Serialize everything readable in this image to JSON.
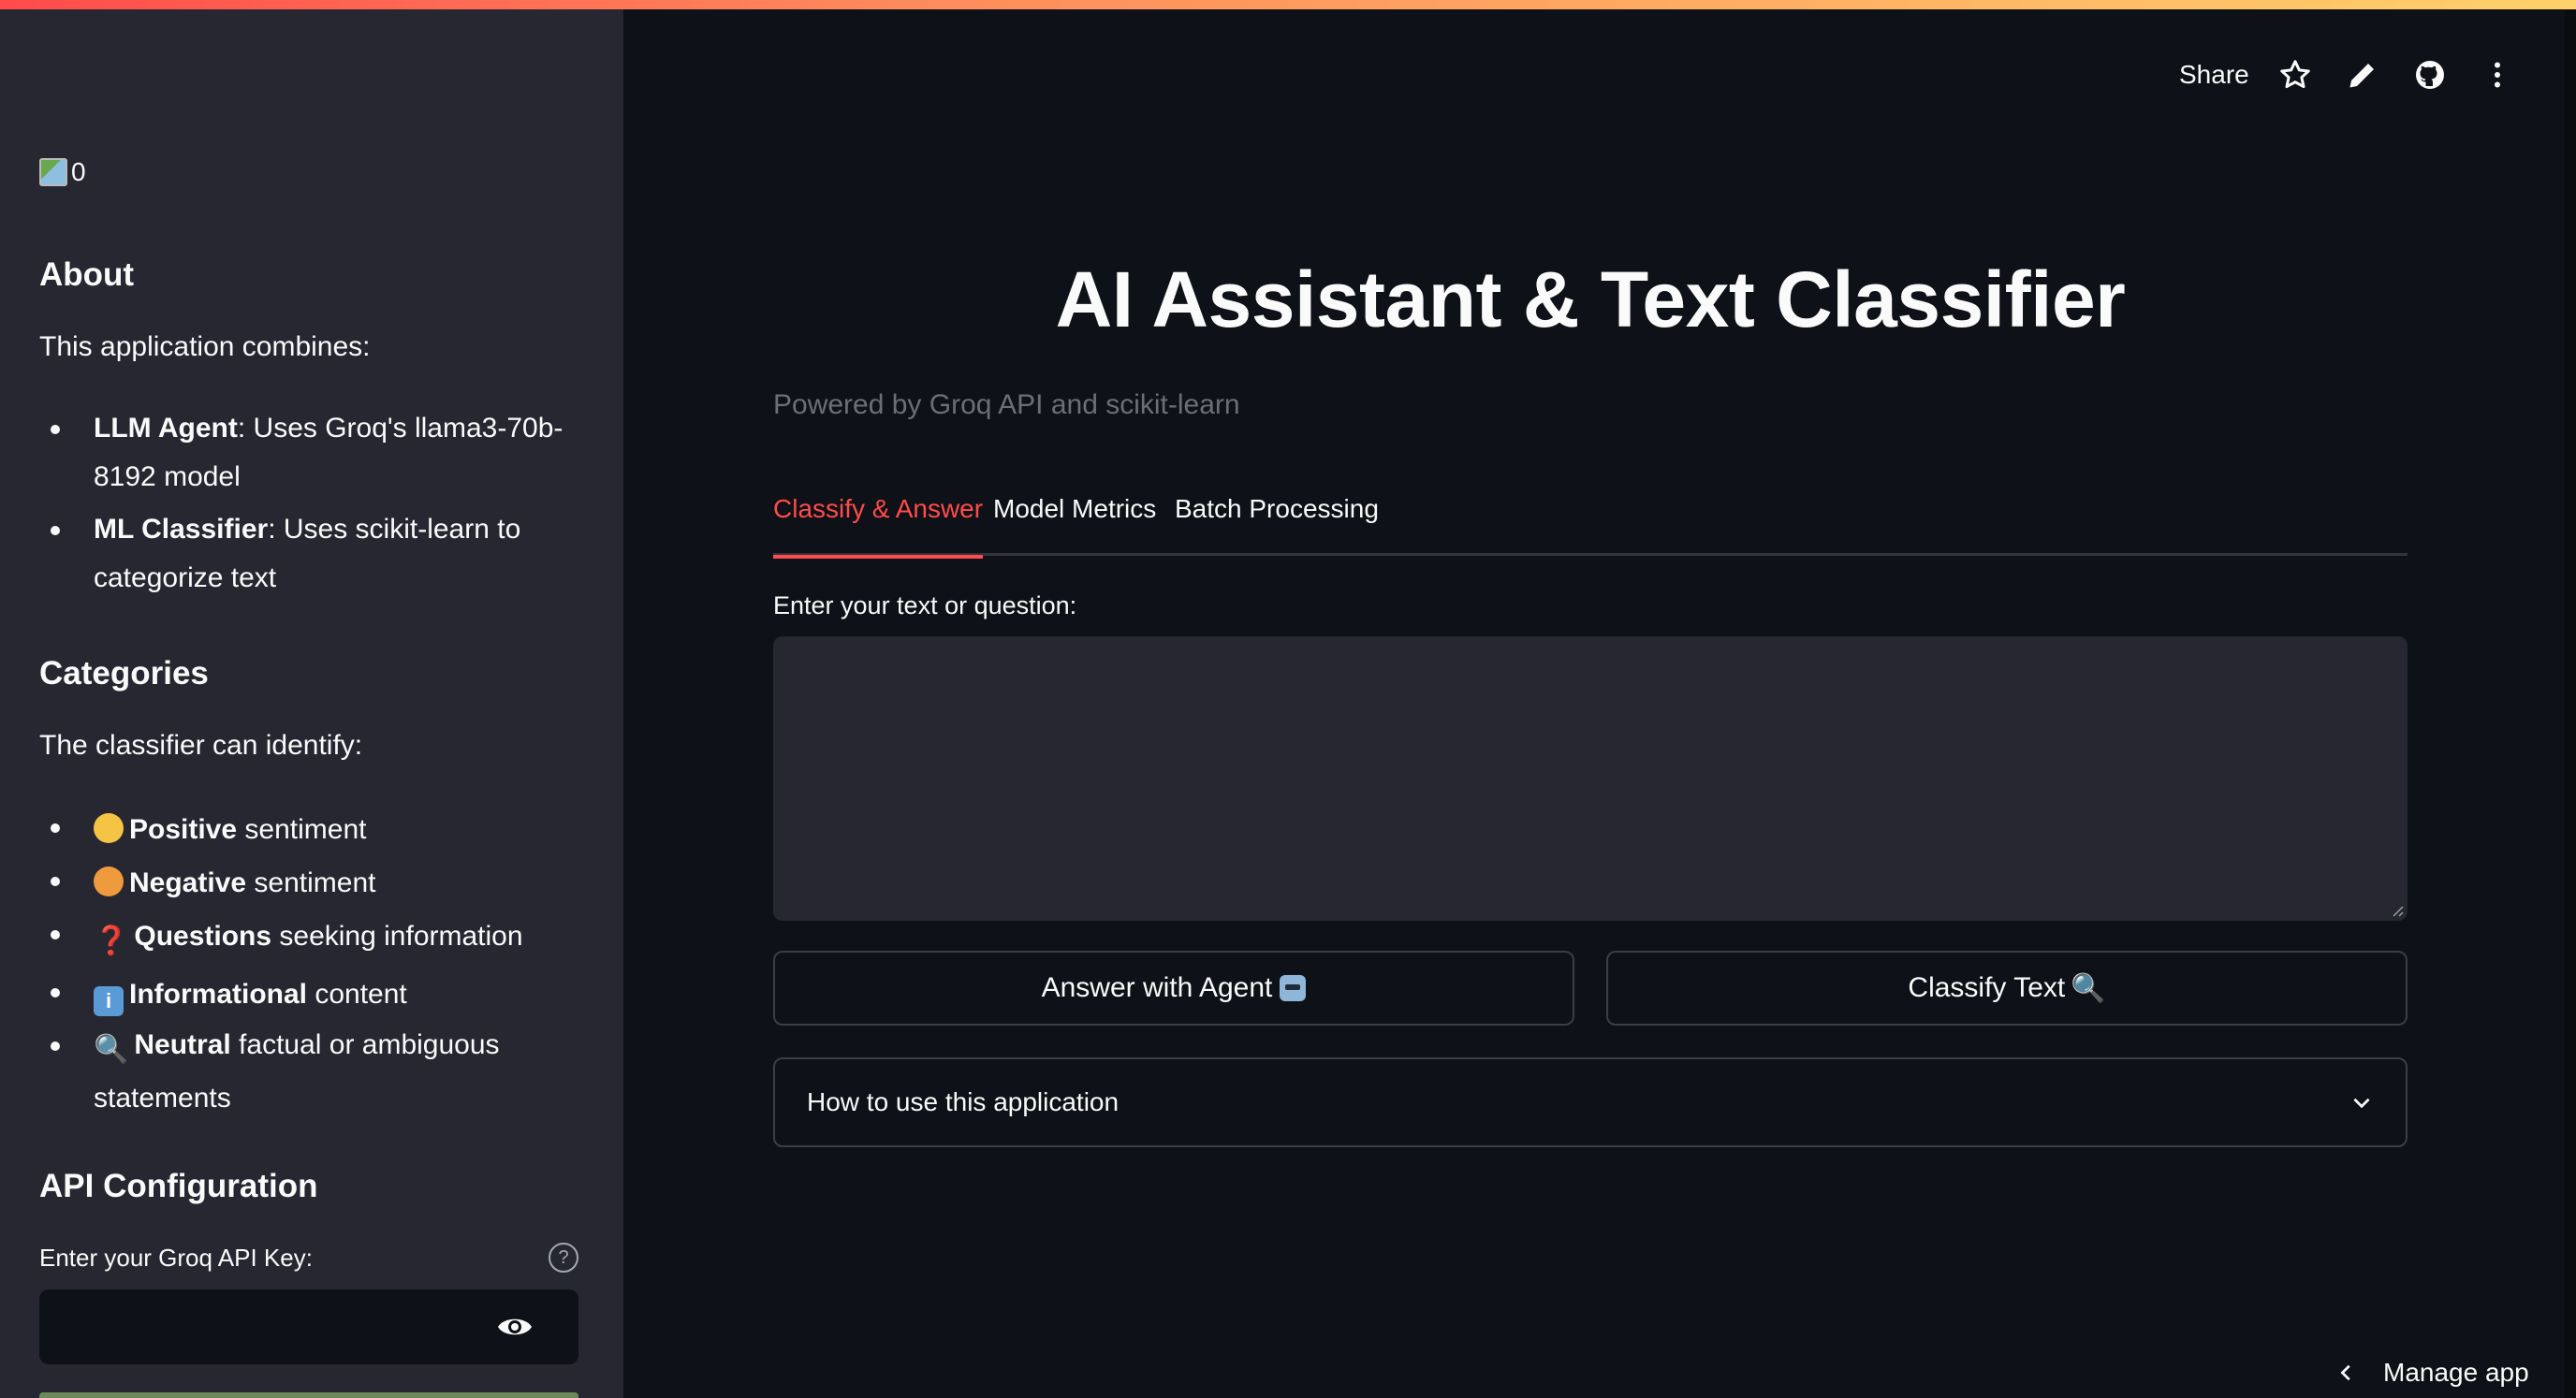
{
  "sidebar": {
    "logo_alt": "0",
    "about_heading": "About",
    "about_text": "This application combines:",
    "about_items": [
      {
        "bold": "LLM Agent",
        "text": ": Uses Groq's llama3-70b-8192 model"
      },
      {
        "bold": "ML Classifier",
        "text": ": Uses scikit-learn to categorize text"
      }
    ],
    "categories_heading": "Categories",
    "categories_text": "The classifier can identify:",
    "categories": [
      {
        "icon": "smile-emoji-icon",
        "bold": "Positive",
        "text": " sentiment"
      },
      {
        "icon": "angry-emoji-icon",
        "bold": "Negative",
        "text": " sentiment"
      },
      {
        "icon": "question-mark-icon",
        "glyph": "❓",
        "bold": "Questions",
        "text": " seeking information"
      },
      {
        "icon": "info-icon",
        "glyph": "i",
        "bold": "Informational",
        "text": " content"
      },
      {
        "icon": "magnifier-icon",
        "glyph": "🔍",
        "bold": "Neutral",
        "text": " factual or ambiguous statements"
      }
    ],
    "api_heading": "API Configuration",
    "api_label": "Enter your Groq API Key:",
    "api_value": ""
  },
  "header": {
    "share_label": "Share"
  },
  "main": {
    "title": "AI Assistant & Text Classifier",
    "subtitle": "Powered by Groq API and scikit-learn",
    "tabs": [
      {
        "label": "Classify & Answer",
        "active": true
      },
      {
        "label": "Model Metrics",
        "active": false
      },
      {
        "label": "Batch Processing",
        "active": false
      }
    ],
    "input_label": "Enter your text or question:",
    "input_value": "",
    "answer_button": "Answer with Agent",
    "classify_button": "Classify Text",
    "expander_label": "How to use this application"
  },
  "footer": {
    "manage_label": "Manage app"
  },
  "colors": {
    "accent": "#ff4b4b",
    "background": "#0e1117",
    "sidebar": "#262730"
  }
}
